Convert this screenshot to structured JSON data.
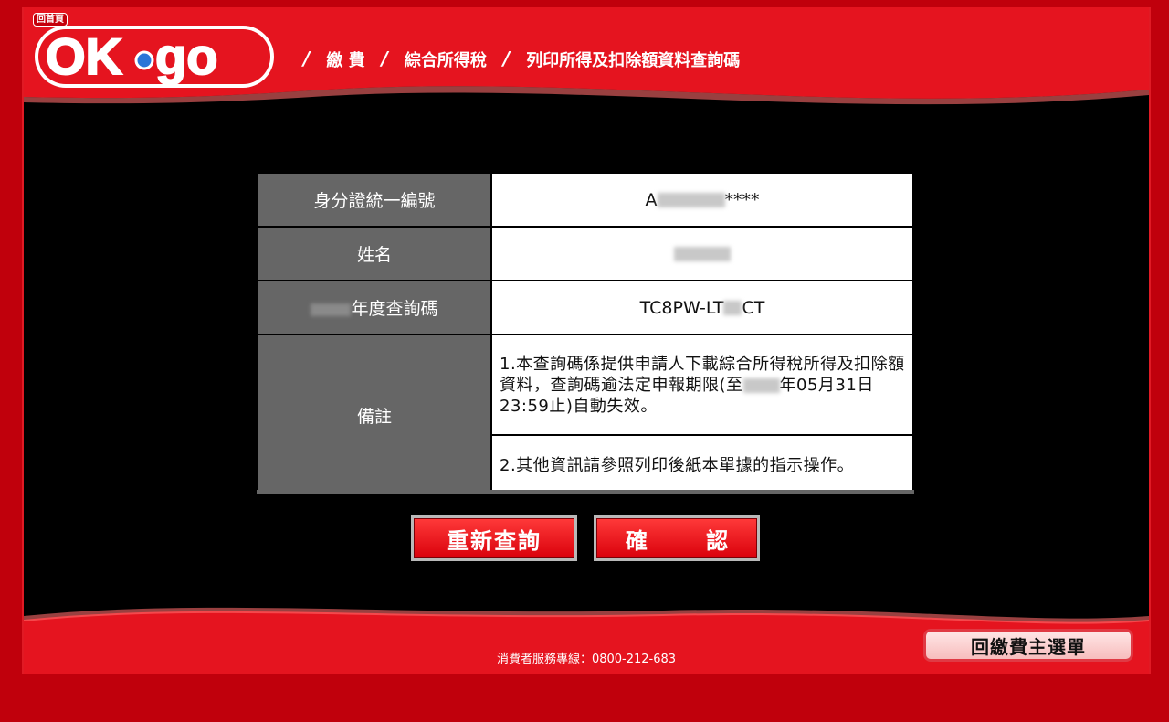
{
  "header": {
    "home_label": "回首頁",
    "logo_text": "OK·go",
    "breadcrumb": [
      "/",
      "繳 費",
      "/",
      "綜合所得稅",
      "/",
      "列印所得及扣除額資料查詢碼"
    ]
  },
  "table": {
    "rows": [
      {
        "label": "身分證統一編號",
        "value_prefix": "A",
        "value_suffix": "****"
      },
      {
        "label": "姓名"
      },
      {
        "label_suffix": "年度查詢碼",
        "value_prefix": "TC8PW-LT",
        "value_suffix": "CT"
      }
    ],
    "notes_label": "備註",
    "note1_pre": "1.本查詢碼係提供申請人下載綜合所得稅所得及扣除額資料，查詢碼逾法定申報期限(至",
    "note1_post": "年05月31日23:59止)自動失效。",
    "note2": "2.其他資訊請參照列印後紙本單據的指示操作。"
  },
  "buttons": {
    "retry": "重新查詢",
    "confirm": "確 認",
    "main_menu": "回繳費主選單"
  },
  "footer": {
    "hotline": "消費者服務專線：0800-212-683"
  },
  "colors": {
    "brand_red": "#e5141f",
    "dark_red": "#b0000a",
    "label_gray": "#666666"
  }
}
